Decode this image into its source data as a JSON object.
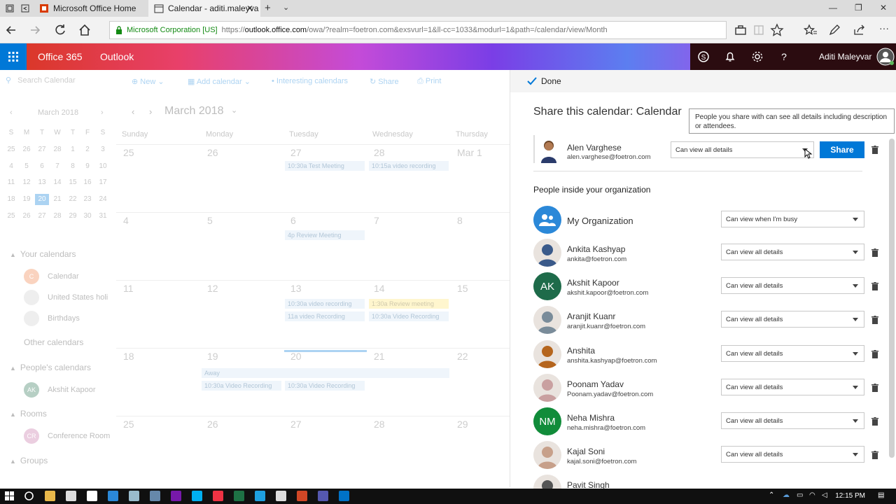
{
  "browser": {
    "tabs": [
      {
        "title": "Microsoft Office Home"
      },
      {
        "title": "Calendar - aditi.maleyva"
      }
    ],
    "address": {
      "org": "Microsoft Corporation [US]",
      "url_prefix": "https://",
      "url_domain": "outlook.office.com",
      "url_path": "/owa/?realm=foetron.com&exsvurl=1&ll-cc=1033&modurl=1&path=/calendar/view/Month"
    }
  },
  "header": {
    "brand": "Office 365",
    "app": "Outlook",
    "user": "Aditi Maleyvar"
  },
  "calendar": {
    "search_placeholder": "Search Calendar",
    "toolbar": {
      "new": "New",
      "add_calendar": "Add calendar",
      "interesting": "Interesting calendars",
      "share": "Share",
      "print": "Print"
    },
    "mini_month": "March 2018",
    "mini_dow": [
      "S",
      "M",
      "T",
      "W",
      "T",
      "F",
      "S"
    ],
    "mini_weeks": [
      [
        "25",
        "26",
        "27",
        "28",
        "1",
        "2",
        "3"
      ],
      [
        "4",
        "5",
        "6",
        "7",
        "8",
        "9",
        "10"
      ],
      [
        "11",
        "12",
        "13",
        "14",
        "15",
        "16",
        "17"
      ],
      [
        "18",
        "19",
        "20",
        "21",
        "22",
        "23",
        "24"
      ],
      [
        "25",
        "26",
        "27",
        "28",
        "29",
        "30",
        "31"
      ]
    ],
    "mini_selected": "20",
    "your_calendars": "Your calendars",
    "your_items": [
      "Calendar",
      "United States holi",
      "Birthdays"
    ],
    "other_calendars": "Other calendars",
    "peoples_calendars": "People's calendars",
    "people_items": [
      "Akshit Kapoor"
    ],
    "rooms": "Rooms",
    "room_items": [
      "Conference Room"
    ],
    "groups": "Groups",
    "month_title": "March 2018",
    "week_days": [
      "Sunday",
      "Monday",
      "Tuesday",
      "Wednesday",
      "Thursday"
    ],
    "weeks": [
      [
        "25",
        "26",
        "27",
        "28",
        "Mar 1"
      ],
      [
        "4",
        "5",
        "6",
        "7",
        "8"
      ],
      [
        "11",
        "12",
        "13",
        "14",
        "15"
      ],
      [
        "18",
        "19",
        "20",
        "21",
        "22"
      ],
      [
        "25",
        "26",
        "27",
        "28",
        "29"
      ]
    ],
    "events": {
      "e1": "10:30a Test Meeting",
      "e2": "10:15a video recording",
      "e3": "4p Review Meeting",
      "e4": "10:30a video recording",
      "e5": "1:30a Review meeting",
      "e6": "11a video Recording",
      "e7": "10:30a Video Recording",
      "e8": "Away",
      "e9": "10:30a Video Recording",
      "e10": "10:30a Video Recording"
    }
  },
  "share": {
    "done": "Done",
    "title": "Share this calendar: Calendar",
    "tooltip": "People you share with can see all details including description or attendees.",
    "invitee": {
      "name": "Alen Varghese",
      "email": "alen.varghese@foetron.com",
      "permission": "Can view all details"
    },
    "share_button": "Share",
    "inside_header": "People inside your organization",
    "org": {
      "name": "My Organization",
      "permission": "Can view when I'm busy"
    },
    "people": [
      {
        "name": "Ankita Kashyap",
        "email": "ankita@foetron.com",
        "permission": "Can view all details",
        "initials": ""
      },
      {
        "name": "Akshit Kapoor",
        "email": "akshit.kapoor@foetron.com",
        "permission": "Can view all details",
        "initials": "AK"
      },
      {
        "name": "Aranjit Kuanr",
        "email": "aranjit.kuanr@foetron.com",
        "permission": "Can view all details",
        "initials": ""
      },
      {
        "name": "Anshita",
        "email": "anshita.kashyap@foetron.com",
        "permission": "Can view all details",
        "initials": ""
      },
      {
        "name": "Poonam Yadav",
        "email": "Poonam.yadav@foetron.com",
        "permission": "Can view all details",
        "initials": ""
      },
      {
        "name": "Neha Mishra",
        "email": "neha.mishra@foetron.com",
        "permission": "Can view all details",
        "initials": "NM"
      },
      {
        "name": "Kajal Soni",
        "email": "kajal.soni@foetron.com",
        "permission": "Can view all details",
        "initials": ""
      },
      {
        "name": "Pavit Singh",
        "email": "",
        "permission": "",
        "initials": ""
      }
    ]
  },
  "taskbar": {
    "time": "12:15 PM"
  },
  "colors": {
    "accent": "#0078d7",
    "darkgreen": "#1e6b4a",
    "green": "#118c3a"
  }
}
